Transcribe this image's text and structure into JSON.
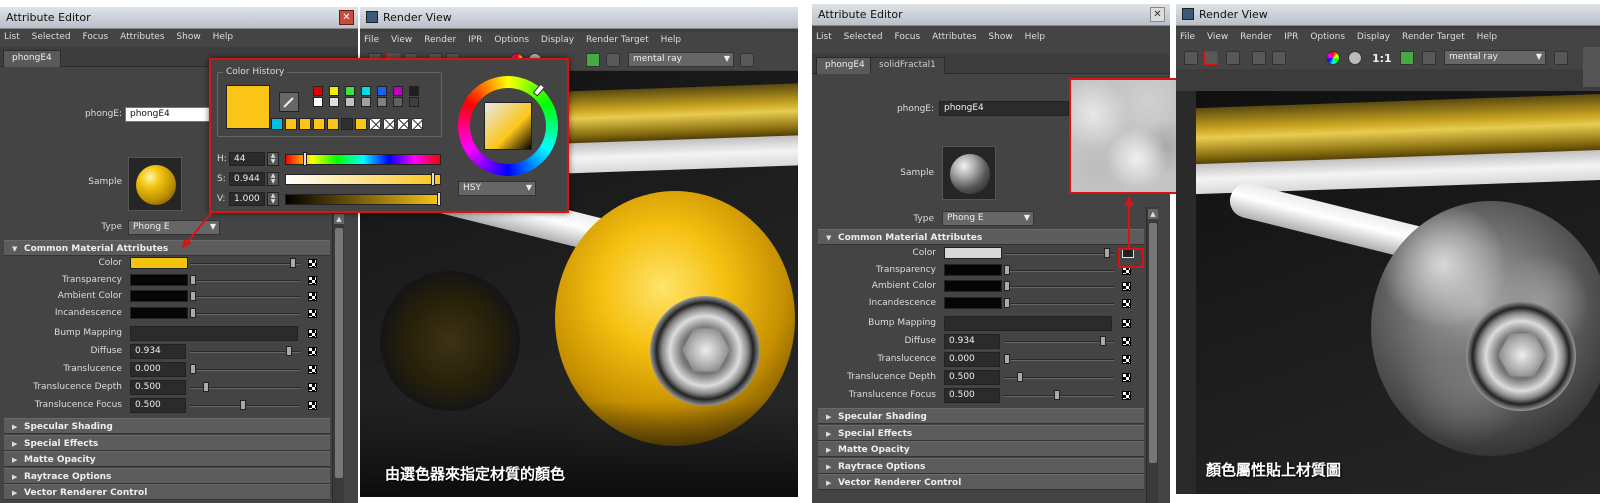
{
  "left": {
    "attr_editor": {
      "title": "Attribute Editor",
      "menu": [
        "List",
        "Selected",
        "Focus",
        "Attributes",
        "Show",
        "Help"
      ],
      "tabs": [
        "phongE4"
      ],
      "name_label": "phongE:",
      "name_value": "phongE4",
      "sample_label": "Sample",
      "type_label": "Type",
      "type_value": "Phong E",
      "sections": [
        "Common Material Attributes",
        "Specular Shading",
        "Special Effects",
        "Matte Opacity",
        "Raytrace Options",
        "Vector Renderer Control"
      ],
      "attrs": [
        {
          "label": "Color",
          "value": ""
        },
        {
          "label": "Transparency",
          "value": ""
        },
        {
          "label": "Ambient Color",
          "value": ""
        },
        {
          "label": "Incandescence",
          "value": ""
        },
        {
          "label": "Bump Mapping",
          "value": ""
        },
        {
          "label": "Diffuse",
          "value": "0.934"
        },
        {
          "label": "Translucence",
          "value": "0.000"
        },
        {
          "label": "Translucence Depth",
          "value": "0.500"
        },
        {
          "label": "Translucence Focus",
          "value": "0.500"
        }
      ],
      "color_swatch": "#f2c40e"
    },
    "render_view": {
      "title": "Render View",
      "menu": [
        "File",
        "View",
        "Render",
        "IPR",
        "Options",
        "Display",
        "Render Target",
        "Help"
      ],
      "renderer": "mental ray",
      "caption": "由選色器來指定材質的顏色"
    },
    "color_picker": {
      "history_label": "Color History",
      "h_label": "H:",
      "h_value": "44",
      "s_label": "S:",
      "s_value": "0.944",
      "v_label": "V:",
      "v_value": "1.000",
      "mode": "HSY",
      "current_color": "#fbc518",
      "history_top": [
        "#e00000",
        "#f2f200",
        "#40e040",
        "#00e0e0",
        "#2060f0",
        "#c000c0",
        "#202020"
      ],
      "history_mid": [
        "#ffffff",
        "#e0e0e0",
        "#c0c0c0",
        "#a0a0a0",
        "#808080",
        "#606060",
        "#404040"
      ],
      "history_bottom": [
        "#00c0e0",
        "#fbc518",
        "#fbc518",
        "#fbc518",
        "#fbc518",
        "#303030",
        "#fbc518"
      ]
    }
  },
  "right": {
    "attr_editor": {
      "title": "Attribute Editor",
      "menu": [
        "List",
        "Selected",
        "Focus",
        "Attributes",
        "Show",
        "Help"
      ],
      "tabs": [
        "phongE4",
        "solidFractal1"
      ],
      "name_label": "phongE:",
      "name_value": "phongE4",
      "sample_label": "Sample",
      "type_label": "Type",
      "type_value": "Phong E",
      "sections": [
        "Common Material Attributes",
        "Specular Shading",
        "Special Effects",
        "Matte Opacity",
        "Raytrace Options",
        "Vector Renderer Control"
      ],
      "attrs": [
        {
          "label": "Color",
          "value": ""
        },
        {
          "label": "Transparency",
          "value": ""
        },
        {
          "label": "Ambient Color",
          "value": ""
        },
        {
          "label": "Incandescence",
          "value": ""
        },
        {
          "label": "Bump Mapping",
          "value": ""
        },
        {
          "label": "Diffuse",
          "value": "0.934"
        },
        {
          "label": "Translucence",
          "value": "0.000"
        },
        {
          "label": "Translucence Depth",
          "value": "0.500"
        },
        {
          "label": "Translucence Focus",
          "value": "0.500"
        }
      ],
      "color_swatch": "#d8d8d8"
    },
    "render_view": {
      "title": "Render View",
      "menu": [
        "File",
        "View",
        "Render",
        "IPR",
        "Options",
        "Display",
        "Render Target",
        "Help"
      ],
      "renderer": "mental ray",
      "ratio": "1:1",
      "caption": "顏色屬性貼上材質圖"
    }
  }
}
